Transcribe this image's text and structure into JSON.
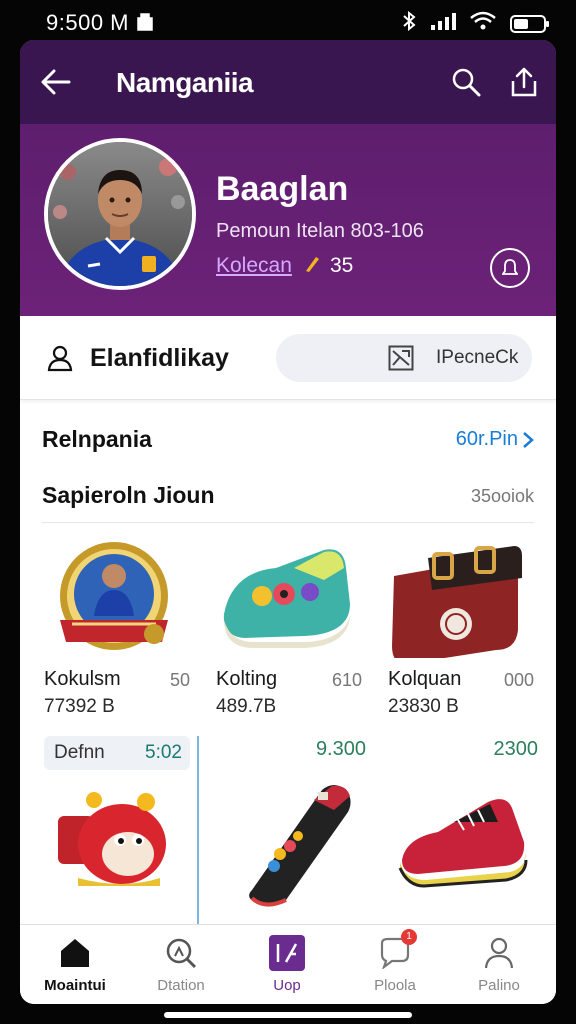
{
  "status": {
    "time": "9:500 M"
  },
  "header": {
    "title": "Namganiia"
  },
  "profile": {
    "name": "Baaglan",
    "subtitle": "Pemoun Itelan 803-106",
    "link": "Kolecan",
    "count": "35"
  },
  "account": {
    "label": "Elanfidlikay",
    "pill_text": "IPecneCk"
  },
  "section1": {
    "title": "Relnpania",
    "link": "60r.Pin"
  },
  "section2": {
    "title": "Sapieroln Jioun",
    "meta": "35ooiok"
  },
  "products_row1": [
    {
      "name": "Kokulsm",
      "qty": "50",
      "price": "77392 B"
    },
    {
      "name": "Kolting",
      "qty": "610",
      "price": "489.7B"
    },
    {
      "name": "Kolquan",
      "qty": "000",
      "price": "23830 B"
    }
  ],
  "products_row2": [
    {
      "chip_label": "Defnn",
      "chip_value": "5:02"
    },
    {
      "price": "9.300"
    },
    {
      "price": "2300"
    }
  ],
  "tabs": [
    {
      "label": "Moaintui",
      "icon": "home-icon"
    },
    {
      "label": "Dtation",
      "icon": "search-icon"
    },
    {
      "label": "Uop",
      "icon": "shop-icon"
    },
    {
      "label": "Ploola",
      "icon": "chat-icon",
      "badge": "1"
    },
    {
      "label": "Palino",
      "icon": "profile-icon"
    }
  ],
  "colors": {
    "header_purple": "#5e1e6e",
    "link_blue": "#1a7cd9",
    "accent_purple": "#6b2c8f",
    "price_green": "#2b7f5d"
  }
}
